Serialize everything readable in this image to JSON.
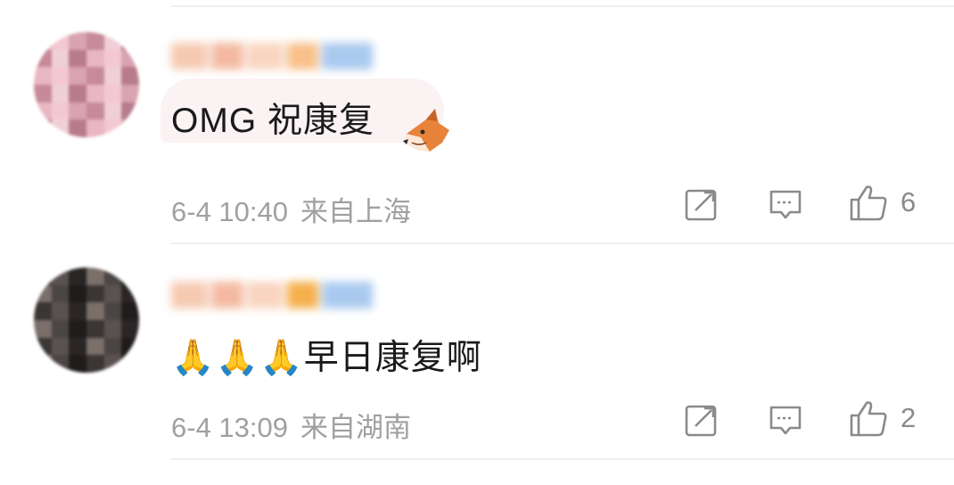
{
  "comments": [
    {
      "text": "OMG 祝康复",
      "time": "6-4 10:40",
      "location": "来自上海",
      "likes": "6",
      "sticker": "fox-sticker",
      "avatar_colors": [
        "#e9b7c3",
        "#f3c8d2",
        "#d9a3b2",
        "#c78a9a",
        "#f0d0d8",
        "#b87b8c"
      ],
      "name_colors": [
        "#f6c9b1",
        "#f4b9a0",
        "#f9d4c0",
        "#f8c08a",
        "#a9c9ef"
      ]
    },
    {
      "text": "早日康复啊",
      "emoji_prefix": "🙏🙏🙏",
      "time": "6-4 13:09",
      "location": "来自湖南",
      "likes": "2",
      "avatar_colors": [
        "#3a3634",
        "#5a5250",
        "#2a2625",
        "#7a6f6a",
        "#4b4543",
        "#1f1c1b"
      ],
      "name_colors": [
        "#f6c9b1",
        "#f4b9a0",
        "#f9d4c0",
        "#f5b04c",
        "#a9c9ef"
      ]
    }
  ],
  "icons": {
    "share": "share-icon",
    "reply": "comment-icon",
    "like": "thumbs-up-icon"
  },
  "colors": {
    "text": "#1a1a1a",
    "meta": "#a0a0a0",
    "icon": "#8a8a8a",
    "divider": "#efefef",
    "bubble": "#fbf2f3"
  }
}
